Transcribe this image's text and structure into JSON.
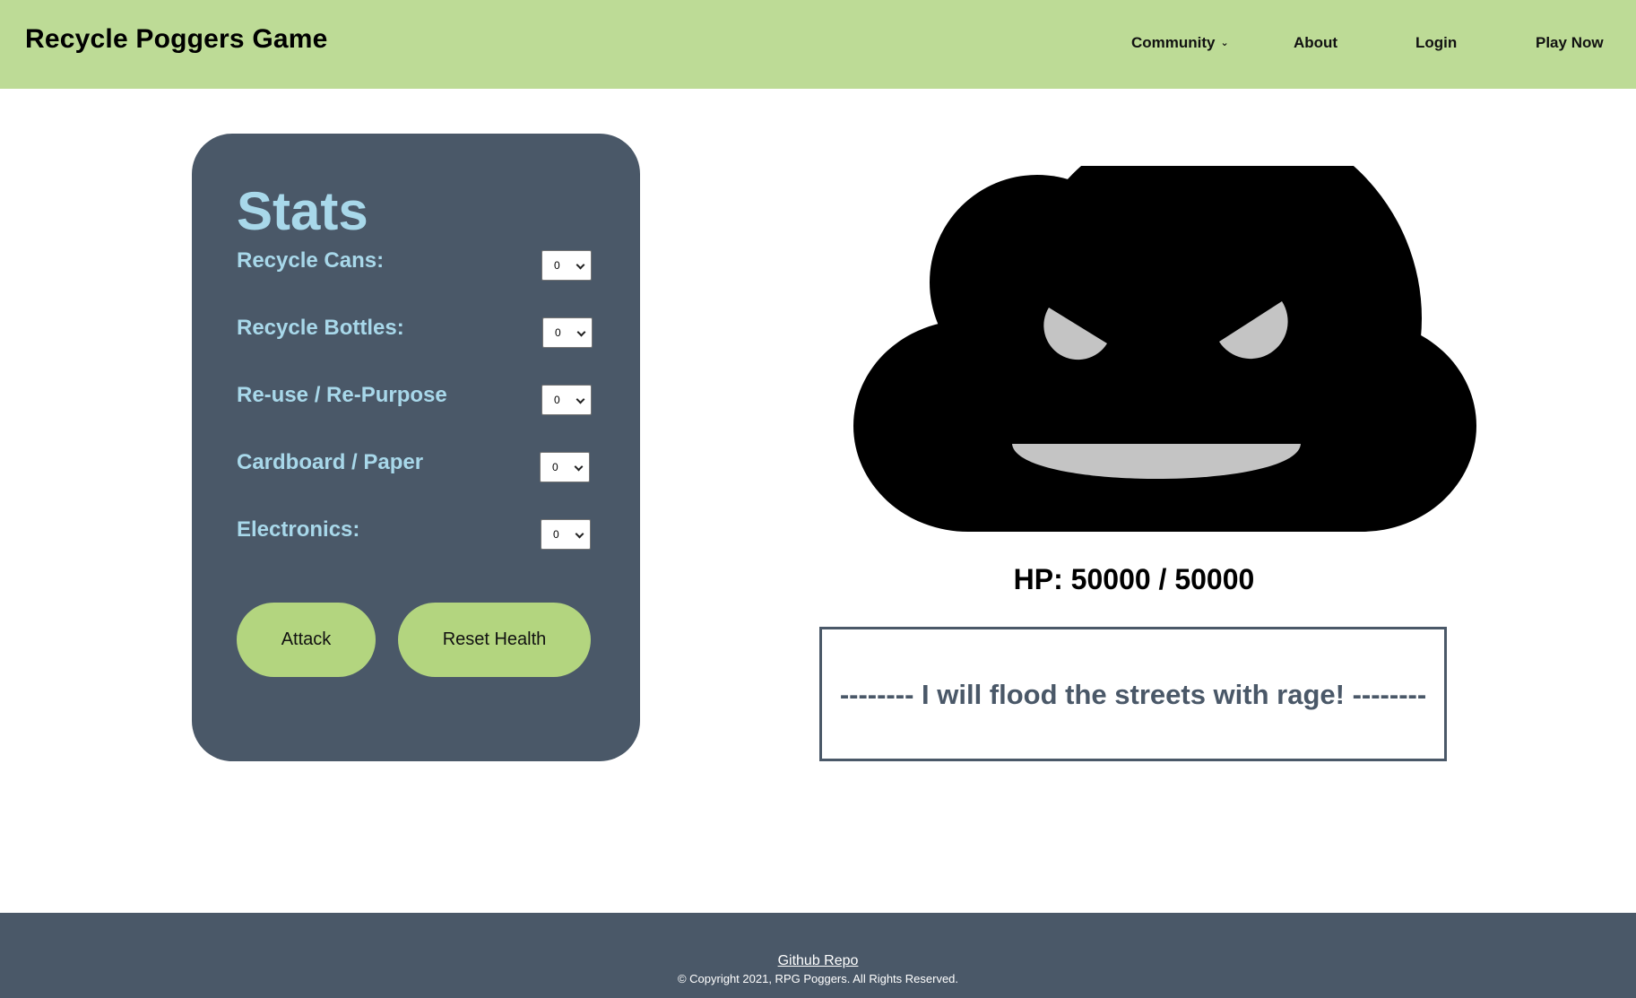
{
  "header": {
    "brand": "Recycle Poggers Game",
    "nav": {
      "community": "Community",
      "about": "About",
      "login": "Login",
      "play_now": "Play Now"
    }
  },
  "stats": {
    "title": "Stats",
    "items": [
      {
        "label": "Recycle Cans:",
        "value": "0"
      },
      {
        "label": "Recycle Bottles:",
        "value": "0"
      },
      {
        "label": "Re-use / Re-Purpose",
        "value": "0"
      },
      {
        "label": "Cardboard / Paper",
        "value": "0"
      },
      {
        "label": "Electronics:",
        "value": "0"
      }
    ],
    "attack_label": "Attack",
    "reset_label": "Reset Health"
  },
  "monster": {
    "hp_text": "HP: 50000 / 50000",
    "hp_current": 50000,
    "hp_max": 50000,
    "message": "-------- I will flood the streets with rage! --------",
    "colors": {
      "body": "#000000",
      "features": "#c4c4c4"
    }
  },
  "footer": {
    "link": "Github Repo",
    "copyright": "© Copyright 2021, RPG Poggers. All Rights Reserved."
  },
  "colors": {
    "header_bg": "#bddb96",
    "panel_bg": "#4a5868",
    "panel_text": "#a8d8ea",
    "button_bg": "#b3d57f",
    "footer_bg": "#4a5868"
  }
}
